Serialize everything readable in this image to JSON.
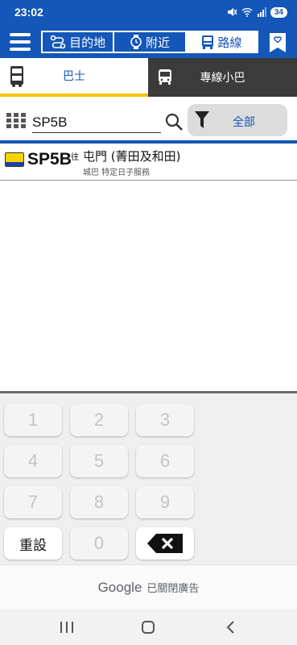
{
  "status_bar": {
    "time": "23:02",
    "battery": "34"
  },
  "app_bar": {
    "segments": [
      {
        "label": "目的地",
        "icon": "route-icon",
        "active": false
      },
      {
        "label": "附近",
        "icon": "watch-icon",
        "active": false
      },
      {
        "label": "路線",
        "icon": "bus-front-icon",
        "active": true
      }
    ]
  },
  "tabs": [
    {
      "label": "巴士",
      "active": true
    },
    {
      "label": "專線小巴",
      "active": false
    }
  ],
  "search": {
    "value": "SP5B",
    "filter_label": "全部"
  },
  "results": [
    {
      "route": "SP5B",
      "direction_mark": "往",
      "destination": "屯門 (菁田及和田)",
      "subtitle": "城巴 特定日子服務"
    }
  ],
  "keypad": {
    "keys": [
      "1",
      "2",
      "3",
      "4",
      "5",
      "6",
      "7",
      "8",
      "9",
      "重設",
      "0"
    ]
  },
  "ad": {
    "brand": "Google",
    "text": "已關閉廣告"
  },
  "colors": {
    "primary": "#1457b8",
    "accent": "#f5c400",
    "dark_tab": "#3b3b3b"
  }
}
